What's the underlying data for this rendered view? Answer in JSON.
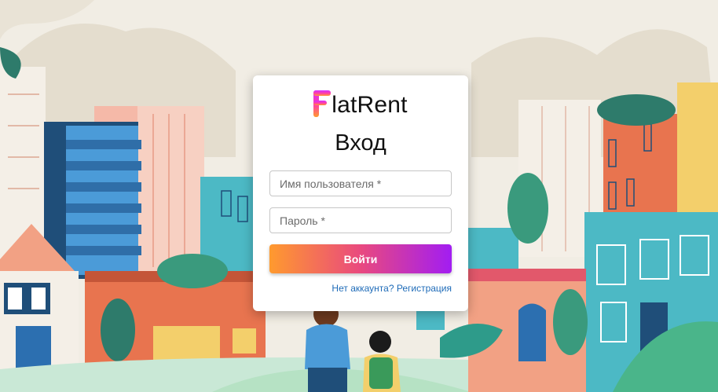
{
  "brand": {
    "name_rest": "latRent",
    "gradient_start": "#ff3fa5",
    "gradient_end": "#ff9a2e"
  },
  "login": {
    "title": "Вход",
    "username_placeholder": "Имя пользователя *",
    "password_placeholder": "Пароль *",
    "submit_label": "Войти",
    "register_link": "Нет аккаунта? Регистрация"
  },
  "colors": {
    "button_gradient": [
      "#ff9a2e",
      "#e9497f",
      "#a21df2"
    ],
    "link": "#1e6bb8",
    "background": "#f1ede4"
  }
}
